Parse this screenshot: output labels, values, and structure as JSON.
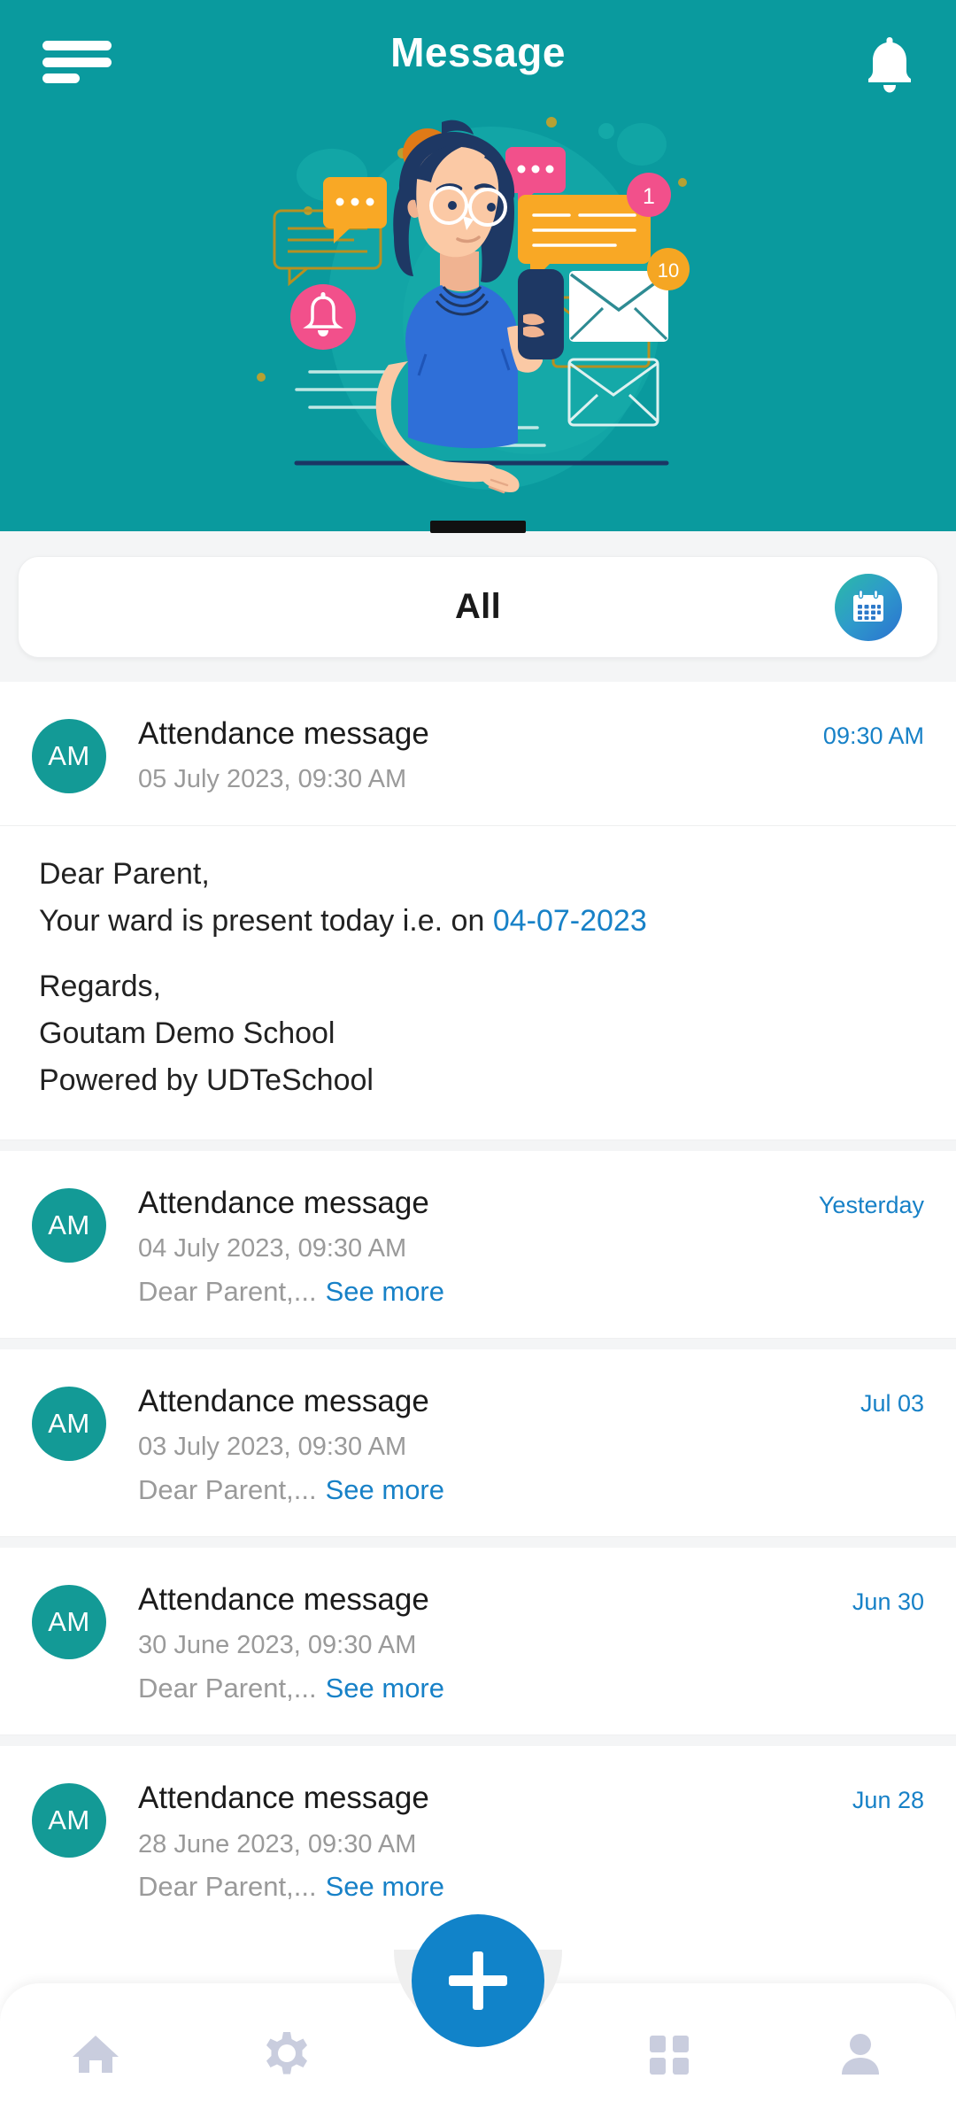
{
  "theme": {
    "header_teal": "#0A9A9E",
    "avatar_teal": "#139A96",
    "link_blue": "#1781C7",
    "fab_blue": "#1183C9",
    "nav_icon_gray": "#C9CDDE",
    "sheet_bg": "#F4F5F6"
  },
  "header": {
    "title": "Message",
    "menu_icon": "hamburger-menu-icon",
    "notification_icon": "bell-icon"
  },
  "hero": {
    "illustration_name": "woman-with-phone-messages-illustration",
    "badges": {
      "alert": "!",
      "orange_bubble_count": "1",
      "envelope_count": "10"
    }
  },
  "filter": {
    "label": "All",
    "calendar_icon": "calendar-icon"
  },
  "messages": [
    {
      "avatar_initials": "AM",
      "title": "Attendance message",
      "date": "05 July 2023, 09:30 AM",
      "time_label": "09:30 AM",
      "expanded": true,
      "body": {
        "greeting": "Dear Parent,",
        "line_prefix": "Your ward is present today i.e. on ",
        "line_date": "04-07-2023",
        "regards": "Regards,",
        "school": "Goutam Demo School",
        "powered": "Powered by UDTeSchool"
      }
    },
    {
      "avatar_initials": "AM",
      "title": "Attendance message",
      "date": "04 July 2023, 09:30 AM",
      "time_label": "Yesterday",
      "expanded": false,
      "preview": "Dear Parent,...",
      "see_more": "See more"
    },
    {
      "avatar_initials": "AM",
      "title": "Attendance message",
      "date": "03 July 2023, 09:30 AM",
      "time_label": "Jul 03",
      "expanded": false,
      "preview": "Dear Parent,...",
      "see_more": "See more"
    },
    {
      "avatar_initials": "AM",
      "title": "Attendance message",
      "date": "30 June 2023, 09:30 AM",
      "time_label": "Jun 30",
      "expanded": false,
      "preview": "Dear Parent,...",
      "see_more": "See more"
    },
    {
      "avatar_initials": "AM",
      "title": "Attendance message",
      "date": "28 June 2023, 09:30 AM",
      "time_label": "Jun 28",
      "expanded": false,
      "preview": "Dear Parent,...",
      "see_more": "See more"
    }
  ],
  "fab": {
    "icon": "plus-icon"
  },
  "bottom_nav": {
    "items": [
      {
        "icon": "home-icon"
      },
      {
        "icon": "gear-icon"
      },
      {
        "icon": "grid-icon"
      },
      {
        "icon": "person-icon"
      }
    ]
  }
}
